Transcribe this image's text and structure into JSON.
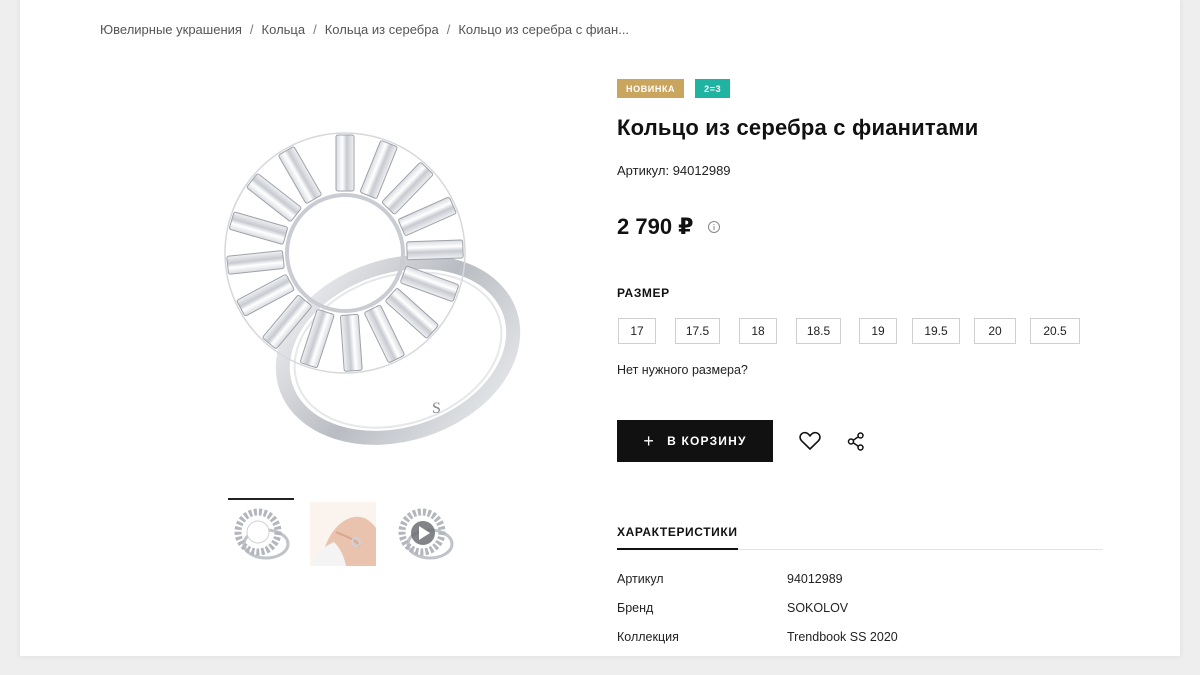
{
  "breadcrumb": [
    "Ювелирные украшения",
    "Кольца",
    "Кольца из серебра",
    "Кольцо из серебра с фиан..."
  ],
  "badges": {
    "new": "НОВИНКА",
    "promo": "2=3"
  },
  "product": {
    "title": "Кольцо из серебра с фианитами",
    "sku_line": "Артикул: 94012989",
    "price": "2 790 ₽"
  },
  "sizes": {
    "label": "РАЗМЕР",
    "options": [
      "17",
      "17.5",
      "18",
      "18.5",
      "19",
      "19.5",
      "20",
      "20.5"
    ],
    "no_size": "Нет нужного размера?"
  },
  "actions": {
    "cart": "В КОРЗИНУ",
    "cart_icon": "plus-icon",
    "favorite_icon": "heart-icon",
    "share_icon": "share-icon"
  },
  "tabs": {
    "characteristics": "ХАРАКТЕРИСТИКИ"
  },
  "specs": [
    {
      "k": "Артикул",
      "v": "94012989"
    },
    {
      "k": "Бренд",
      "v": "SOKOLOV"
    },
    {
      "k": "Коллекция",
      "v": "Trendbook SS 2020"
    }
  ],
  "colors": {
    "badge_new": "#c9a55e",
    "badge_promo": "#1fb3a1",
    "button": "#111111"
  }
}
